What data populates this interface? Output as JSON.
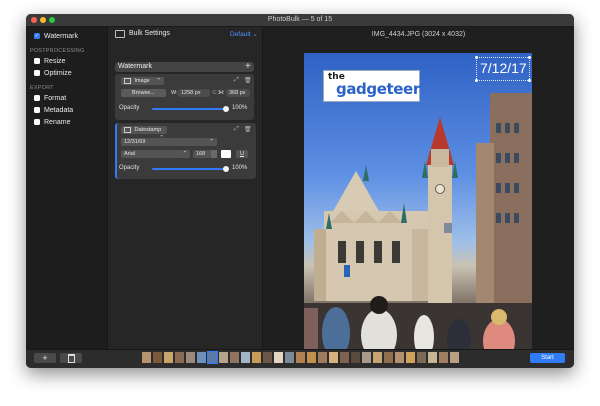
{
  "window": {
    "title": "PhotoBulk — 5 of 15"
  },
  "sidebar": {
    "watermark_label": "Watermark",
    "postprocessing_header": "POSTPROCESSING",
    "resize_label": "Resize",
    "optimize_label": "Optimize",
    "export_header": "EXPORT",
    "format_label": "Format",
    "metadata_label": "Metadata",
    "rename_label": "Rename"
  },
  "settings": {
    "bulk_label": "Bulk Settings",
    "preset": "Default",
    "watermark_section": "Watermark",
    "image_type": "Image",
    "browse_label": "Browse...",
    "w_label": "W:",
    "w_value": "1258 px",
    "h_label": "H:",
    "h_value": "368 px",
    "opacity_label": "Opacity",
    "opacity_value": "100%",
    "datestamp_type": "Datestamp",
    "date_format": "12/31/69",
    "font": "Arial",
    "font_size": "168",
    "underline_label": "U",
    "opacity2_label": "Opacity",
    "opacity2_value": "100%"
  },
  "preview": {
    "filename": "IMG_4434.JPG (3024 x 4032)",
    "watermark_text_1": "the",
    "watermark_text_2": "gadgeteer",
    "date_stamp": "7/12/17"
  },
  "bottom": {
    "add_label": "+",
    "start_label": "Start"
  },
  "colors": {
    "accent": "#2f7cf6",
    "window_bg": "#2a2a2a"
  },
  "icons": {
    "add": "plus-icon",
    "delete": "trash-icon",
    "sidebar_toggle": "sidebar-icon"
  }
}
